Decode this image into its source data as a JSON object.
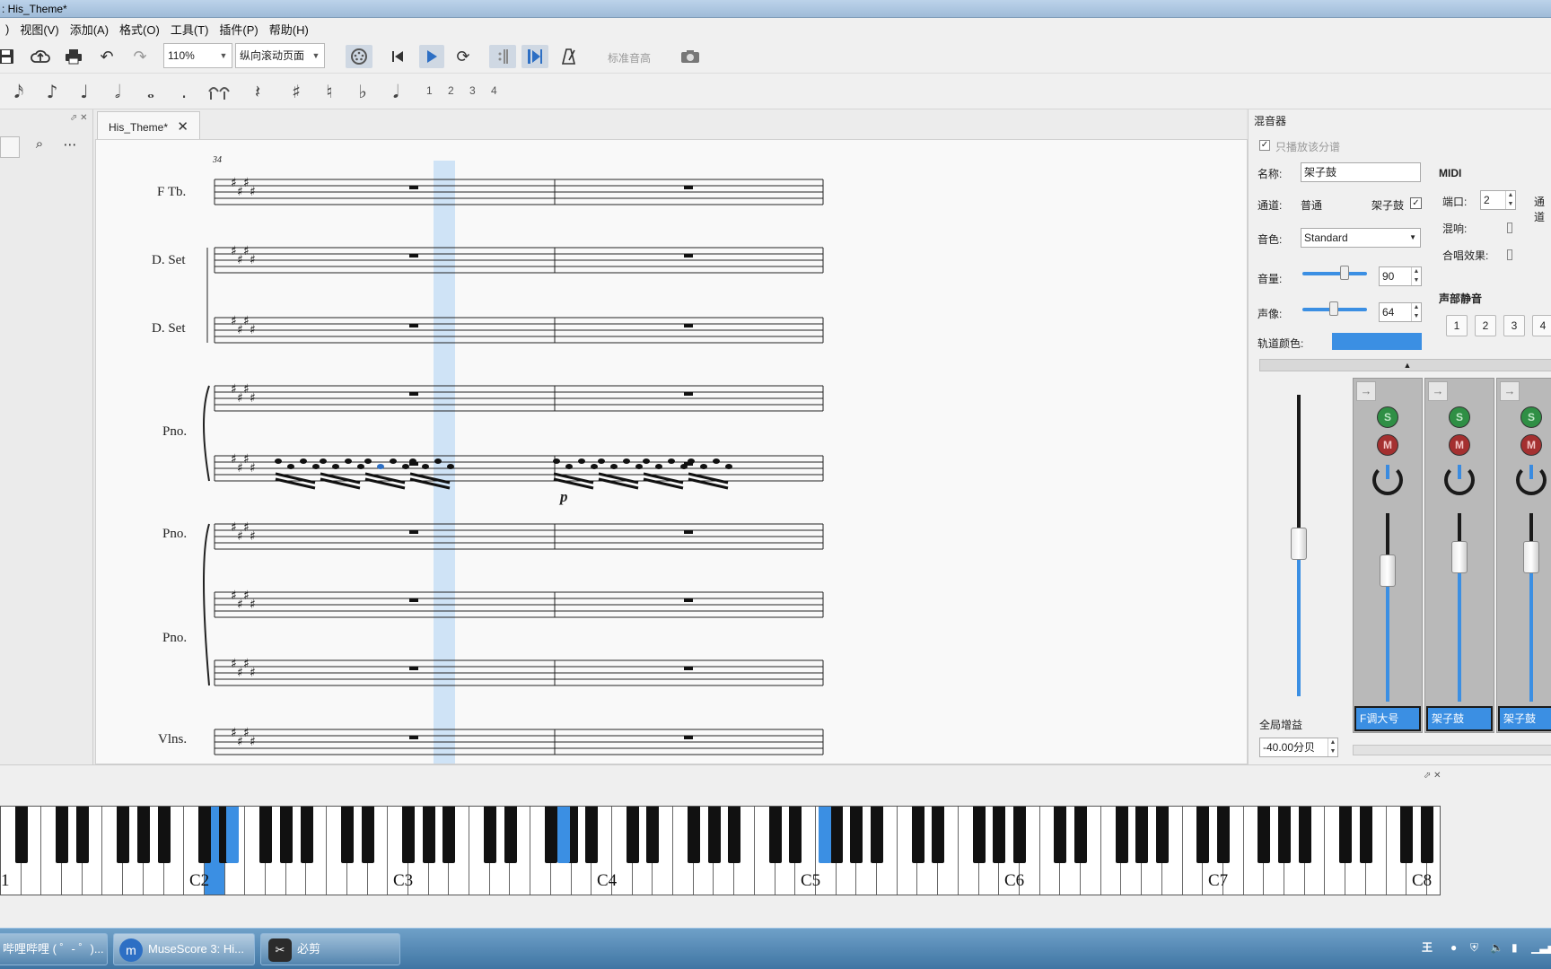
{
  "window": {
    "title": ": His_Theme*"
  },
  "menu": [
    "视图(V)",
    "添加(A)",
    "格式(O)",
    "工具(T)",
    "插件(P)",
    "帮助(H)"
  ],
  "toolbar": {
    "zoom": "110%",
    "view_mode": "纵向滚动页面",
    "concert_pitch": "标准音高"
  },
  "note_toolbar": {
    "voices": [
      "1",
      "2",
      "3",
      "4"
    ]
  },
  "tab": {
    "label": "His_Theme*"
  },
  "score": {
    "measure_number": "34",
    "instruments": [
      "F Tb.",
      "D. Set",
      "D. Set",
      "Pno.",
      "Pno.",
      "Pno.",
      "Vlns."
    ],
    "dynamic": "p"
  },
  "mixer": {
    "title": "混音器",
    "play_only_part": "只播放该分谱",
    "name_label": "名称:",
    "name_value": "架子鼓",
    "channel_label": "通道:",
    "channel_value": "普通",
    "channel_inst": "架子鼓",
    "sound_label": "音色:",
    "sound_value": "Standard",
    "volume_label": "音量:",
    "volume_value": "90",
    "pan_label": "声像:",
    "pan_value": "64",
    "color_label": "轨道颜色:",
    "track_color": "#3b8fe3",
    "midi_title": "MIDI",
    "port_label": "端口:",
    "port_value": "2",
    "channel2_label": "通道",
    "reverb_label": "混响:",
    "chorus_label": "合唱效果:",
    "voice_mute_title": "声部静音",
    "voice_mute_buttons": [
      "1",
      "2",
      "3",
      "4"
    ],
    "master_gain_label": "全局增益",
    "master_gain_value": "-40.00分贝",
    "strips": [
      {
        "name": "F调大号",
        "solo": "S",
        "mute": "M"
      },
      {
        "name": "架子鼓",
        "solo": "S",
        "mute": "M"
      },
      {
        "name": "架子鼓",
        "solo": "S",
        "mute": "M"
      }
    ]
  },
  "piano": {
    "labels": [
      "1",
      "C2",
      "C3",
      "C4",
      "C5",
      "C6",
      "C7",
      "C8"
    ]
  },
  "taskbar": {
    "tasks": [
      "哔哩哔哩 ( ゜- ゜)...",
      "MuseScore 3: Hi...",
      "必剪"
    ],
    "ime": "王"
  },
  "colors": {
    "accent": "#3b8fe3",
    "selection": "#cfe3f6"
  }
}
